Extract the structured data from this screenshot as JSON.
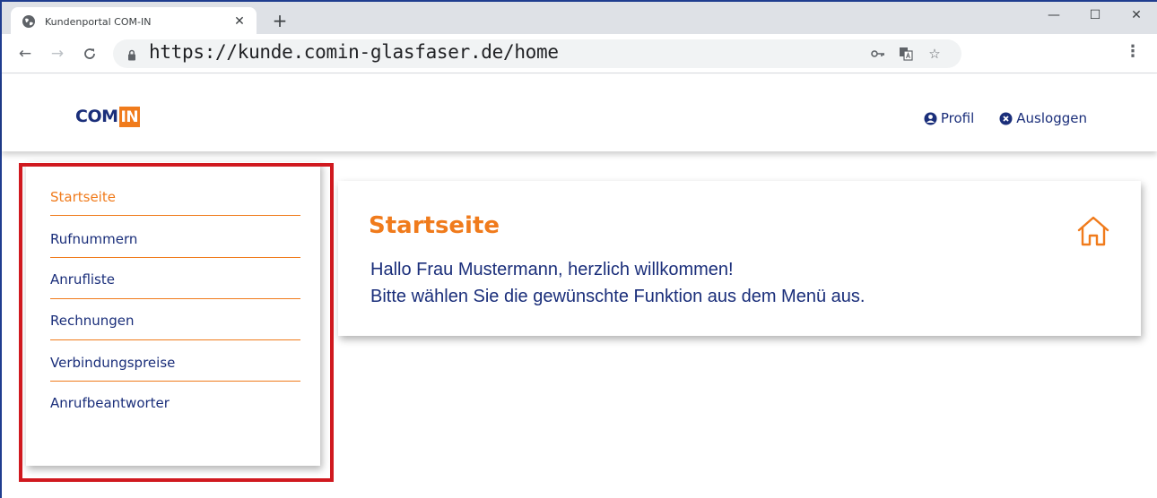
{
  "browser": {
    "tab_title": "Kundenportal COM-IN",
    "url": "https://kunde.comin-glasfaser.de/home"
  },
  "site": {
    "logo_com": "COM",
    "logo_in": "IN",
    "header_links": {
      "profile": "Profil",
      "logout": "Ausloggen"
    }
  },
  "sidebar": {
    "items": [
      {
        "label": "Startseite",
        "active": true
      },
      {
        "label": "Rufnummern",
        "active": false
      },
      {
        "label": "Anrufliste",
        "active": false
      },
      {
        "label": "Rechnungen",
        "active": false
      },
      {
        "label": "Verbindungspreise",
        "active": false
      },
      {
        "label": "Anrufbeantworter",
        "active": false
      }
    ]
  },
  "main": {
    "title": "Startseite",
    "greeting": "Hallo Frau Mustermann, herzlich willkommen!",
    "instruction": "Bitte wählen Sie die gewünschte Funktion aus dem Menü aus."
  },
  "colors": {
    "brand_blue": "#1a2e7a",
    "brand_orange": "#f07b1c",
    "highlight_red": "#d0191f"
  },
  "icons": {
    "favicon": "globe-icon",
    "profile": "user-circle-icon",
    "logout": "close-circle-icon",
    "content": "home-icon"
  }
}
